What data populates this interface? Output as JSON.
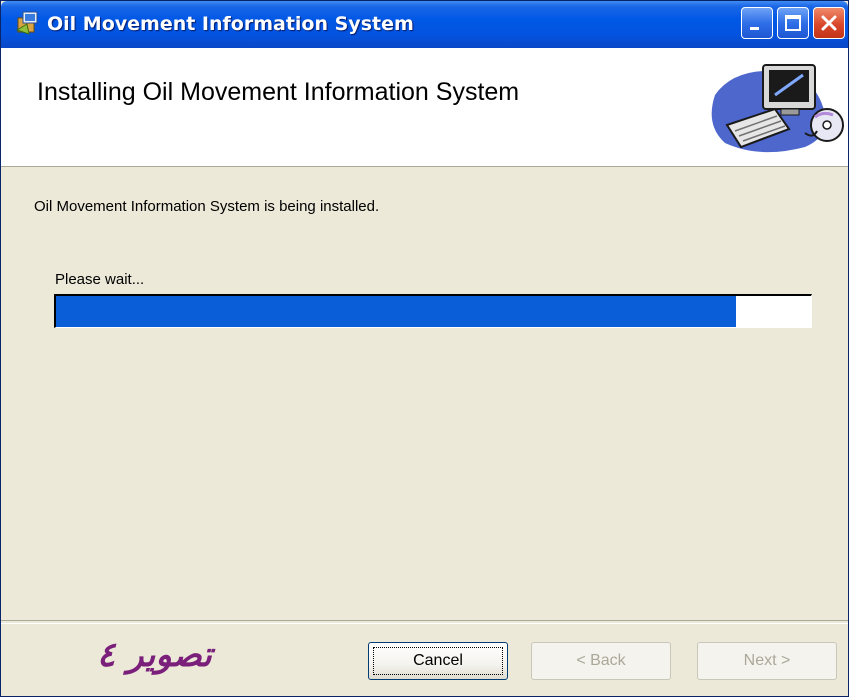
{
  "window": {
    "title": "Oil Movement Information System"
  },
  "banner": {
    "heading": "Installing Oil Movement Information System",
    "art_icon": "computer-install-icon"
  },
  "body": {
    "status": "Oil Movement Information System is being installed.",
    "wait_label": "Please wait...",
    "progress_fraction": 0.9
  },
  "footer": {
    "caption": "تصوير ٤",
    "cancel_label": "Cancel",
    "back_label": "< Back",
    "next_label": "Next >"
  },
  "colors": {
    "titlebar": "#0058e6",
    "progress": "#0a5fd8",
    "caption": "#7a1f7a",
    "dialog_bg": "#ece9d8"
  }
}
